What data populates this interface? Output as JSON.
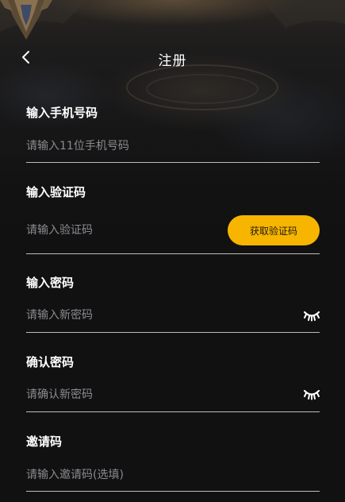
{
  "header": {
    "title": "注册",
    "back_icon": "chevron-left-icon"
  },
  "form": {
    "phone": {
      "label": "输入手机号码",
      "placeholder": "请输入11位手机号码",
      "value": ""
    },
    "code": {
      "label": "输入验证码",
      "placeholder": "请输入验证码",
      "value": "",
      "button_label": "获取验证码"
    },
    "password": {
      "label": "输入密码",
      "placeholder": "请输入新密码",
      "value": "",
      "toggle_icon": "eye-closed-icon"
    },
    "confirm": {
      "label": "确认密码",
      "placeholder": "请确认新密码",
      "value": "",
      "toggle_icon": "eye-closed-icon"
    },
    "invite": {
      "label": "邀请码",
      "placeholder": "请输入邀请码(选填)",
      "value": ""
    }
  },
  "colors": {
    "background": "#111112",
    "accent_button": "#f7b500",
    "text_primary": "#ffffff",
    "placeholder": "#8b8b90",
    "divider": "#bdbdbd"
  }
}
